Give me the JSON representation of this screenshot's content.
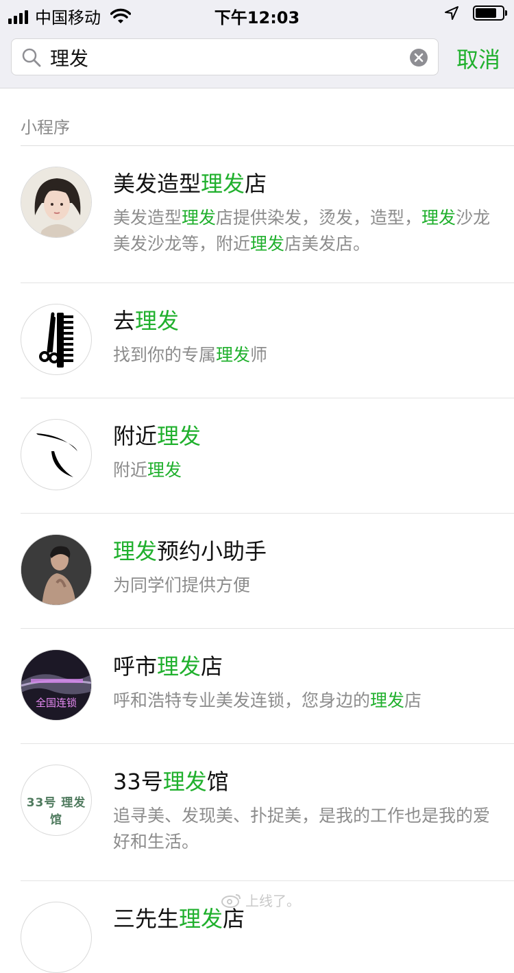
{
  "status_bar": {
    "carrier": "中国移动",
    "time": "下午12:03"
  },
  "search": {
    "query": "理发",
    "cancel_label": "取消"
  },
  "section_label": "小程序",
  "results": [
    {
      "title": [
        {
          "t": "美发造型"
        },
        {
          "t": "理发",
          "hl": true
        },
        {
          "t": "店"
        }
      ],
      "desc": [
        {
          "t": "美发造型"
        },
        {
          "t": "理发",
          "hl": true
        },
        {
          "t": "店提供染发，烫发，造型，"
        },
        {
          "t": "理发",
          "hl": true
        },
        {
          "t": "沙龙美发沙龙等，附近"
        },
        {
          "t": "理发",
          "hl": true
        },
        {
          "t": "店美发店。"
        }
      ],
      "avatar": "woman-portrait"
    },
    {
      "title": [
        {
          "t": "去"
        },
        {
          "t": "理发",
          "hl": true
        }
      ],
      "desc": [
        {
          "t": "找到你的专属"
        },
        {
          "t": "理发",
          "hl": true
        },
        {
          "t": "师"
        }
      ],
      "avatar": "scissors-comb-icon"
    },
    {
      "title": [
        {
          "t": "附近"
        },
        {
          "t": "理发",
          "hl": true
        }
      ],
      "desc": [
        {
          "t": "附近"
        },
        {
          "t": "理发",
          "hl": true
        }
      ],
      "avatar": "swoosh-logo"
    },
    {
      "title": [
        {
          "t": "理发",
          "hl": true
        },
        {
          "t": "预约小助手"
        }
      ],
      "desc": [
        {
          "t": "为同学们提供方便"
        }
      ],
      "avatar": "man-portrait"
    },
    {
      "title": [
        {
          "t": "呼市"
        },
        {
          "t": "理发",
          "hl": true
        },
        {
          "t": "店"
        }
      ],
      "desc": [
        {
          "t": "呼和浩特专业美发连锁，您身边的"
        },
        {
          "t": "理发",
          "hl": true
        },
        {
          "t": "店"
        }
      ],
      "avatar": "galaxy-logo",
      "avatar_text": "全国连锁"
    },
    {
      "title": [
        {
          "t": "33号"
        },
        {
          "t": "理发",
          "hl": true
        },
        {
          "t": "馆"
        }
      ],
      "desc": [
        {
          "t": "追寻美、发现美、扑捉美，是我的工作也是我的爱好和生活。"
        }
      ],
      "avatar": "text-logo",
      "avatar_text": "33号 理发馆"
    }
  ],
  "partial_row": {
    "title": [
      {
        "t": "三先生"
      },
      {
        "t": "理发",
        "hl": true
      },
      {
        "t": "店"
      }
    ]
  },
  "watermark": "上线了。",
  "colors": {
    "accent": "#20b02d",
    "secondary_text": "#8c8c8c",
    "bar_bg": "#efeff4"
  }
}
